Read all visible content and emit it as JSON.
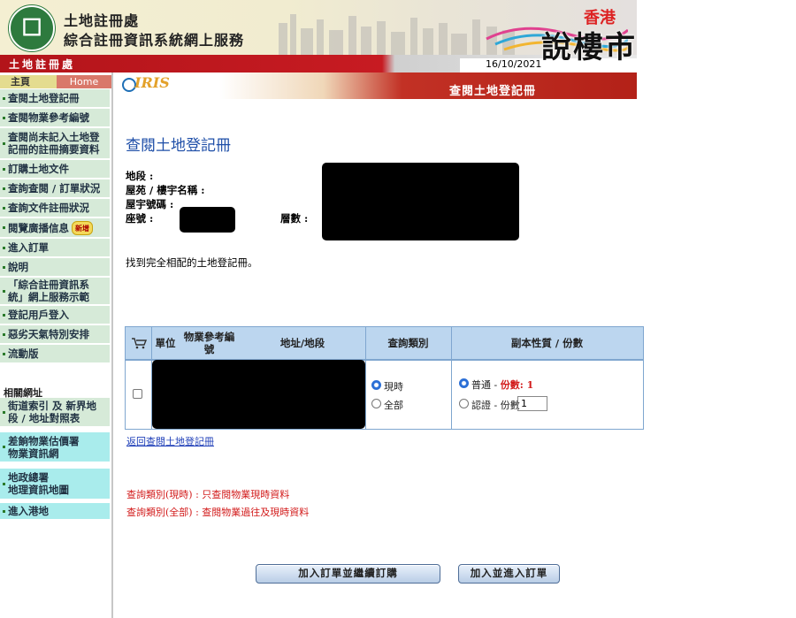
{
  "header": {
    "logo_glyph": "☐",
    "org_line1": "土地註冊處",
    "org_line2": "綜合註冊資訊系統網上服務",
    "brand": "香港",
    "redbar_title": "土地註冊處",
    "date": "16/10/2021",
    "watermark": "說樓市"
  },
  "sidebar": {
    "home_label": "主頁",
    "home_eng": "Home",
    "items": [
      {
        "label": "查閱土地登記冊"
      },
      {
        "label": "查閱物業參考編號"
      },
      {
        "label": "查閱尚未記入土地登\n記冊的註冊摘要資料"
      },
      {
        "label": "訂購土地文件"
      },
      {
        "label": "查詢查閱 / 訂單狀況"
      },
      {
        "label": "查詢文件註冊狀況"
      },
      {
        "label": "閱覽廣播信息",
        "badge": "新增"
      },
      {
        "label": "進入訂單"
      },
      {
        "label": "說明"
      },
      {
        "label": "「綜合註冊資訊系\n統」網上服務示範"
      },
      {
        "label": "登記用戶登入"
      },
      {
        "label": "惡劣天氣特別安排"
      },
      {
        "label": "流動版"
      }
    ],
    "related_title": "相關網址",
    "related": [
      {
        "label": "街道索引 及 新界地\n段 / 地址對照表"
      },
      {
        "label": "差餉物業估價署\n物業資訊網"
      },
      {
        "label": "地政總署\n地理資訊地圖"
      },
      {
        "label": "進入港地"
      }
    ]
  },
  "banner": {
    "logo": "IRIS",
    "title": "查閱土地登記冊"
  },
  "main": {
    "title": "查閱土地登記冊",
    "fields": {
      "lot": "地段 :",
      "estate": "屋苑 / 樓宇名稱 :",
      "building_no": "屋宇號碼 :",
      "block": "座號 :",
      "floor": "層數 :"
    },
    "found_msg": "找到完全相配的土地登記冊。",
    "table": {
      "headers": {
        "unit": "單位",
        "prn": "物業參考編\n號",
        "address": "地址/地段",
        "search_type": "查詢類別",
        "copy_nature": "副本性質 / 份數"
      },
      "row": {
        "search_current": "現時",
        "search_all": "全部",
        "copy_normal": "普通 - ",
        "copy_normal_qty": "份數: 1",
        "copy_cert": "認證 - 份數",
        "copy_cert_value": "1"
      }
    },
    "back_link": "返回查閱土地登記冊",
    "notes": [
      "查詢類別(現時) :  只查閱物業現時資料",
      "查詢類別(全部) :  查閱物業過往及現時資料"
    ],
    "buttons": {
      "add_continue": "加入訂單並繼續訂購",
      "add_enter": "加入並進入訂單"
    }
  },
  "colors": {
    "accent_blue": "#1f4fa8",
    "red": "#d21a1a",
    "nav_green": "#d6ead8",
    "table_header": "#bcd6ef"
  }
}
